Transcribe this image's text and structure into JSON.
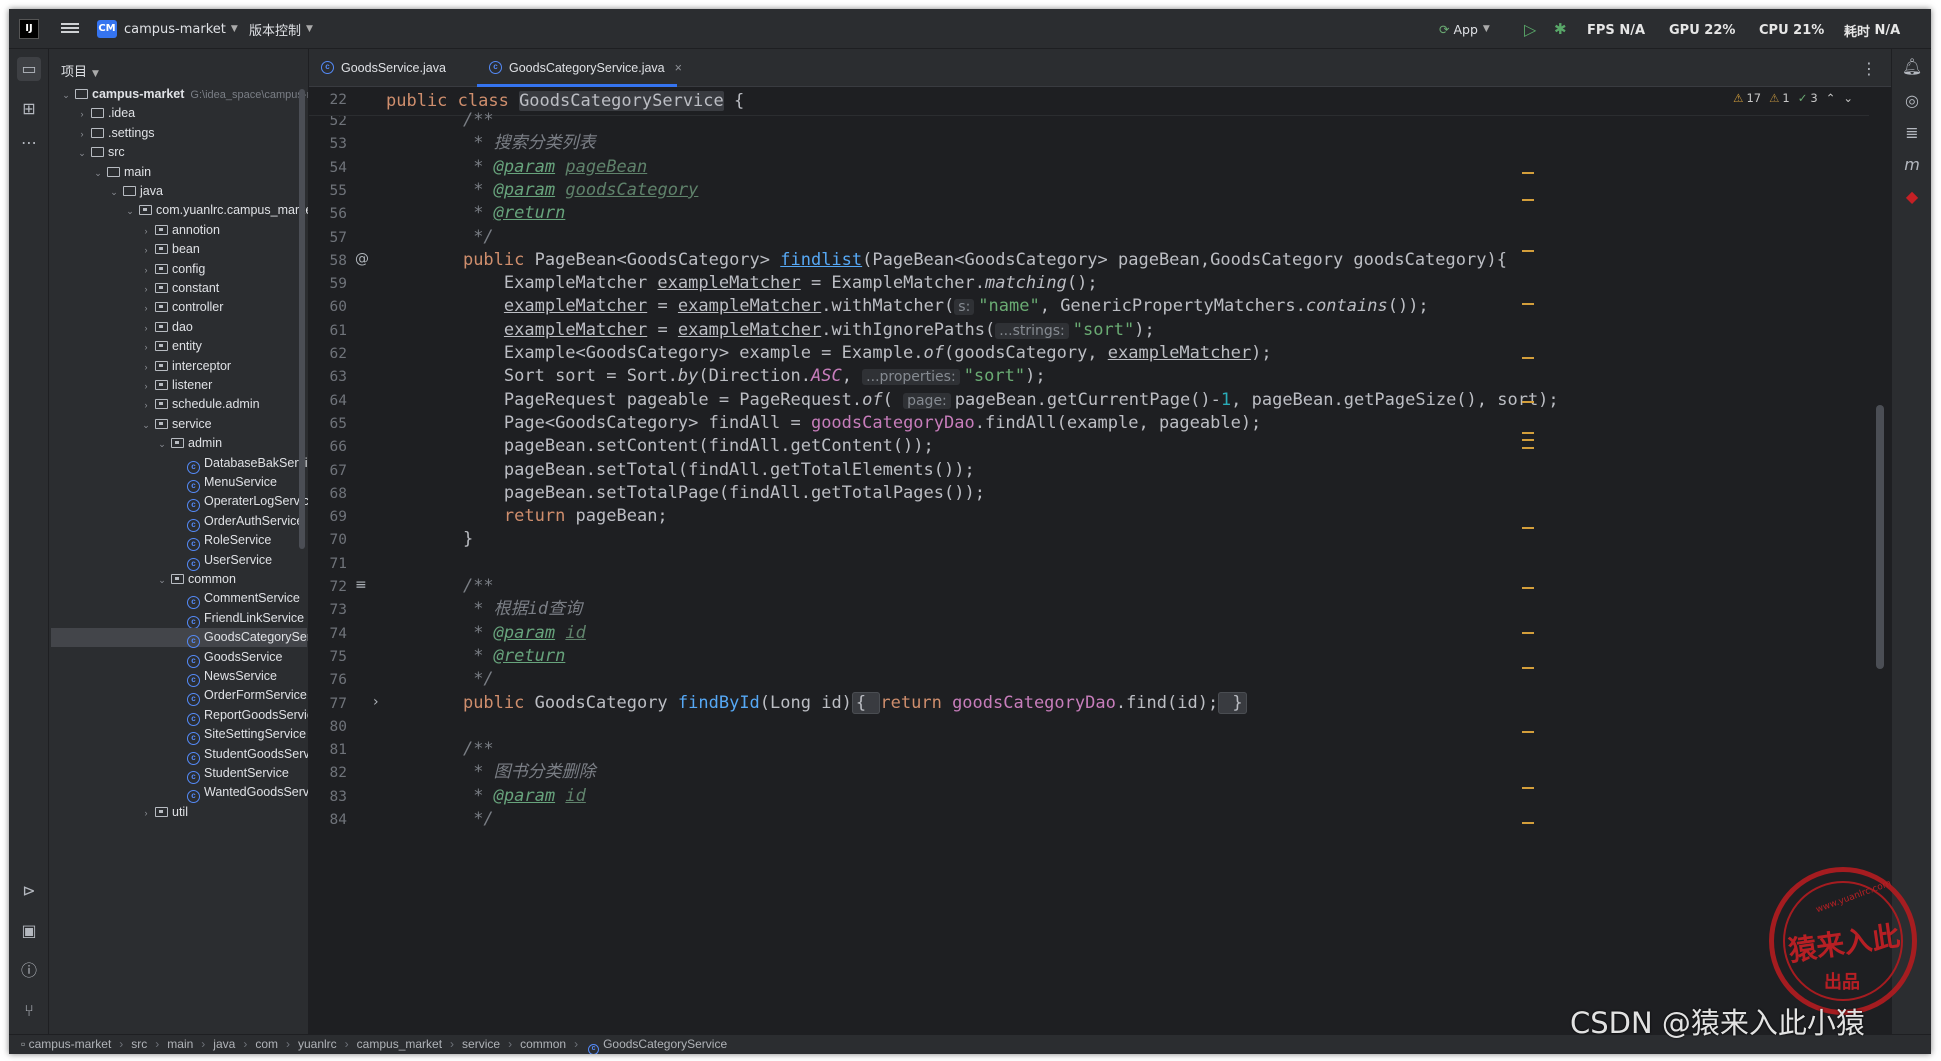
{
  "titlebar": {
    "project": "campus-market",
    "project_badge": "CM",
    "vcs": "版本控制",
    "run_config": "App",
    "fps_label": "FPS",
    "fps_value": "N/A",
    "gpu_label": "GPU",
    "gpu_value": "22%",
    "cpu_label": "CPU",
    "cpu_value": "21%",
    "time_label": "耗时",
    "time_value": "N/A"
  },
  "project_panel": {
    "title": "项目",
    "tree": [
      {
        "label": "campus-market",
        "path": "G:\\idea_space\\campus-marke",
        "depth": 0,
        "kind": "module",
        "open": true
      },
      {
        "label": ".idea",
        "depth": 1,
        "kind": "folder",
        "open": false
      },
      {
        "label": ".settings",
        "depth": 1,
        "kind": "folder",
        "open": false
      },
      {
        "label": "src",
        "depth": 1,
        "kind": "folder",
        "open": true
      },
      {
        "label": "main",
        "depth": 2,
        "kind": "folder",
        "open": true
      },
      {
        "label": "java",
        "depth": 3,
        "kind": "folder",
        "open": true
      },
      {
        "label": "com.yuanlrc.campus_market",
        "depth": 4,
        "kind": "pkg",
        "open": true
      },
      {
        "label": "annotion",
        "depth": 5,
        "kind": "pkg",
        "open": false
      },
      {
        "label": "bean",
        "depth": 5,
        "kind": "pkg",
        "open": false
      },
      {
        "label": "config",
        "depth": 5,
        "kind": "pkg",
        "open": false
      },
      {
        "label": "constant",
        "depth": 5,
        "kind": "pkg",
        "open": false
      },
      {
        "label": "controller",
        "depth": 5,
        "kind": "pkg",
        "open": false
      },
      {
        "label": "dao",
        "depth": 5,
        "kind": "pkg",
        "open": false
      },
      {
        "label": "entity",
        "depth": 5,
        "kind": "pkg",
        "open": false
      },
      {
        "label": "interceptor",
        "depth": 5,
        "kind": "pkg",
        "open": false
      },
      {
        "label": "listener",
        "depth": 5,
        "kind": "pkg",
        "open": false
      },
      {
        "label": "schedule.admin",
        "depth": 5,
        "kind": "pkg",
        "open": false
      },
      {
        "label": "service",
        "depth": 5,
        "kind": "pkg",
        "open": true
      },
      {
        "label": "admin",
        "depth": 6,
        "kind": "pkg",
        "open": true
      },
      {
        "label": "DatabaseBakService",
        "depth": 7,
        "kind": "class"
      },
      {
        "label": "MenuService",
        "depth": 7,
        "kind": "class"
      },
      {
        "label": "OperaterLogService",
        "depth": 7,
        "kind": "class"
      },
      {
        "label": "OrderAuthService",
        "depth": 7,
        "kind": "class"
      },
      {
        "label": "RoleService",
        "depth": 7,
        "kind": "class"
      },
      {
        "label": "UserService",
        "depth": 7,
        "kind": "class"
      },
      {
        "label": "common",
        "depth": 6,
        "kind": "pkg",
        "open": true
      },
      {
        "label": "CommentService",
        "depth": 7,
        "kind": "class"
      },
      {
        "label": "FriendLinkService",
        "depth": 7,
        "kind": "class"
      },
      {
        "label": "GoodsCategoryService",
        "depth": 7,
        "kind": "class",
        "selected": true
      },
      {
        "label": "GoodsService",
        "depth": 7,
        "kind": "class"
      },
      {
        "label": "NewsService",
        "depth": 7,
        "kind": "class"
      },
      {
        "label": "OrderFormService",
        "depth": 7,
        "kind": "class"
      },
      {
        "label": "ReportGoodsService",
        "depth": 7,
        "kind": "class"
      },
      {
        "label": "SiteSettingService",
        "depth": 7,
        "kind": "class"
      },
      {
        "label": "StudentGoodsService",
        "depth": 7,
        "kind": "class"
      },
      {
        "label": "StudentService",
        "depth": 7,
        "kind": "class"
      },
      {
        "label": "WantedGoodsService",
        "depth": 7,
        "kind": "class"
      },
      {
        "label": "util",
        "depth": 5,
        "kind": "pkg",
        "open": false
      }
    ]
  },
  "tabs": [
    {
      "label": "GoodsService.java",
      "active": false
    },
    {
      "label": "GoodsCategoryService.java",
      "active": true,
      "close": "×"
    }
  ],
  "inspections": {
    "warn_count": "17",
    "weak_count": "1",
    "ok_count": "3"
  },
  "sticky_line": {
    "num": "22",
    "t1": "public class ",
    "t2": "GoodsCategoryService",
    "t3": " {"
  },
  "code": [
    {
      "n": "52",
      "s": [
        [
          "cm",
          "/**"
        ]
      ]
    },
    {
      "n": "53",
      "s": [
        [
          "cm",
          " * "
        ],
        [
          "cm",
          "搜索分类列表"
        ]
      ]
    },
    {
      "n": "54",
      "s": [
        [
          "cm",
          " * "
        ],
        [
          "tgu",
          "@param"
        ],
        [
          "tg",
          " "
        ],
        [
          "pr",
          "pageBean"
        ]
      ]
    },
    {
      "n": "55",
      "s": [
        [
          "cm",
          " * "
        ],
        [
          "tgu",
          "@param"
        ],
        [
          "tg",
          " "
        ],
        [
          "pr",
          "goodsCategory"
        ]
      ]
    },
    {
      "n": "56",
      "s": [
        [
          "cm",
          " * "
        ],
        [
          "tgu",
          "@return"
        ]
      ]
    },
    {
      "n": "57",
      "s": [
        [
          "cm",
          " */"
        ]
      ]
    },
    {
      "n": "58",
      "s": [
        [
          "kw",
          "public "
        ],
        [
          "",
          "PageBean<GoodsCategory> "
        ],
        [
          "fnu",
          "findlist"
        ],
        [
          "",
          "(PageBean<GoodsCategory> pageBean,GoodsCategory goodsCategory){"
        ]
      ]
    },
    {
      "n": "59",
      "s": [
        [
          "",
          "    ExampleMatcher "
        ],
        [
          "ul",
          "exampleMatcher"
        ],
        [
          "",
          " = ExampleMatcher."
        ],
        [
          "it",
          "matching"
        ],
        [
          "",
          "();"
        ]
      ]
    },
    {
      "n": "60",
      "s": [
        [
          "",
          "    "
        ],
        [
          "ul",
          "exampleMatcher"
        ],
        [
          "",
          " = "
        ],
        [
          "ul",
          "exampleMatcher"
        ],
        [
          "",
          ".withMatcher("
        ],
        [
          "hint",
          "s:"
        ],
        [
          "st",
          "\"name\""
        ],
        [
          "",
          ", GenericPropertyMatchers."
        ],
        [
          "it",
          "contains"
        ],
        [
          "",
          "());"
        ]
      ]
    },
    {
      "n": "61",
      "s": [
        [
          "",
          "    "
        ],
        [
          "ul",
          "exampleMatcher"
        ],
        [
          "",
          " = "
        ],
        [
          "ul",
          "exampleMatcher"
        ],
        [
          "",
          ".withIgnorePaths("
        ],
        [
          "hint",
          "...strings:"
        ],
        [
          "st",
          "\"sort\""
        ],
        [
          "",
          ");"
        ]
      ]
    },
    {
      "n": "62",
      "s": [
        [
          "",
          "    Example<GoodsCategory> example = Example."
        ],
        [
          "it",
          "of"
        ],
        [
          "",
          "(goodsCategory, "
        ],
        [
          "ul",
          "exampleMatcher"
        ],
        [
          "",
          ");"
        ]
      ]
    },
    {
      "n": "63",
      "s": [
        [
          "",
          "    Sort sort = Sort."
        ],
        [
          "it",
          "by"
        ],
        [
          "",
          "(Direction."
        ],
        [
          "fl it",
          "ASC"
        ],
        [
          "",
          ", "
        ],
        [
          "hint",
          "...properties:"
        ],
        [
          "st",
          "\"sort\""
        ],
        [
          "",
          ");"
        ]
      ]
    },
    {
      "n": "64",
      "s": [
        [
          "",
          "    PageRequest pageable = PageRequest."
        ],
        [
          "it",
          "of"
        ],
        [
          "",
          "( "
        ],
        [
          "hint",
          "page:"
        ],
        [
          "",
          "pageBean.getCurrentPage()-"
        ],
        [
          "nm",
          "1"
        ],
        [
          "",
          ", pageBean.getPageSize(), sort);"
        ]
      ]
    },
    {
      "n": "65",
      "s": [
        [
          "",
          "    Page<GoodsCategory> findAll = "
        ],
        [
          "fl",
          "goodsCategoryDao"
        ],
        [
          "",
          ".findAll(example, pageable);"
        ]
      ]
    },
    {
      "n": "66",
      "s": [
        [
          "",
          "    pageBean.setContent(findAll.getContent());"
        ]
      ]
    },
    {
      "n": "67",
      "s": [
        [
          "",
          "    pageBean.setTotal(findAll.getTotalElements());"
        ]
      ]
    },
    {
      "n": "68",
      "s": [
        [
          "",
          "    pageBean.setTotalPage(findAll.getTotalPages());"
        ]
      ]
    },
    {
      "n": "69",
      "s": [
        [
          "kw",
          "    return "
        ],
        [
          "",
          "pageBean;"
        ]
      ]
    },
    {
      "n": "70",
      "s": [
        [
          "",
          "}"
        ]
      ]
    },
    {
      "n": "71",
      "s": [
        [
          "",
          ""
        ]
      ]
    },
    {
      "n": "72",
      "s": [
        [
          "cm",
          "/**"
        ]
      ]
    },
    {
      "n": "73",
      "s": [
        [
          "cm",
          " * "
        ],
        [
          "cm",
          "根据id查询"
        ]
      ]
    },
    {
      "n": "74",
      "s": [
        [
          "cm",
          " * "
        ],
        [
          "tgu",
          "@param"
        ],
        [
          "tg",
          " "
        ],
        [
          "pr",
          "id"
        ]
      ]
    },
    {
      "n": "75",
      "s": [
        [
          "cm",
          " * "
        ],
        [
          "tgu",
          "@return"
        ]
      ]
    },
    {
      "n": "76",
      "s": [
        [
          "cm",
          " */"
        ]
      ]
    },
    {
      "n": "77",
      "s": [
        [
          "kw",
          "public "
        ],
        [
          "",
          "GoodsCategory "
        ],
        [
          "fn",
          "findById"
        ],
        [
          "",
          "(Long id)"
        ],
        [
          "fb",
          "{ "
        ],
        [
          "kw",
          "return "
        ],
        [
          "fl",
          "goodsCategoryDao"
        ],
        [
          "",
          ".find(id);"
        ],
        [
          "fb",
          " }"
        ]
      ]
    },
    {
      "n": "80",
      "s": [
        [
          "",
          ""
        ]
      ]
    },
    {
      "n": "81",
      "s": [
        [
          "cm",
          "/**"
        ]
      ]
    },
    {
      "n": "82",
      "s": [
        [
          "cm",
          " * "
        ],
        [
          "cm",
          "图书分类删除"
        ]
      ]
    },
    {
      "n": "83",
      "s": [
        [
          "cm",
          " * "
        ],
        [
          "tgu",
          "@param"
        ],
        [
          "tg",
          " "
        ],
        [
          "pr",
          "id"
        ]
      ]
    },
    {
      "n": "84",
      "s": [
        [
          "cm",
          " */"
        ]
      ]
    }
  ],
  "statusbar": [
    "campus-market",
    "src",
    "main",
    "java",
    "com",
    "yuanlrc",
    "campus_market",
    "service",
    "common",
    "GoodsCategoryService"
  ],
  "watermark": "CSDN @猿来入此小猿",
  "stamp": {
    "main": "猿来入此",
    "sub": "出品",
    "url": "www.yuanlrc.com"
  },
  "colors": {
    "accent": "#3574f0",
    "bg": "#1e1f22",
    "panel": "#2b2d30",
    "keyword": "#cf8e6d",
    "string": "#6aab73",
    "function": "#56a8f5",
    "field": "#c77dbb",
    "warning": "#d39e3b"
  }
}
